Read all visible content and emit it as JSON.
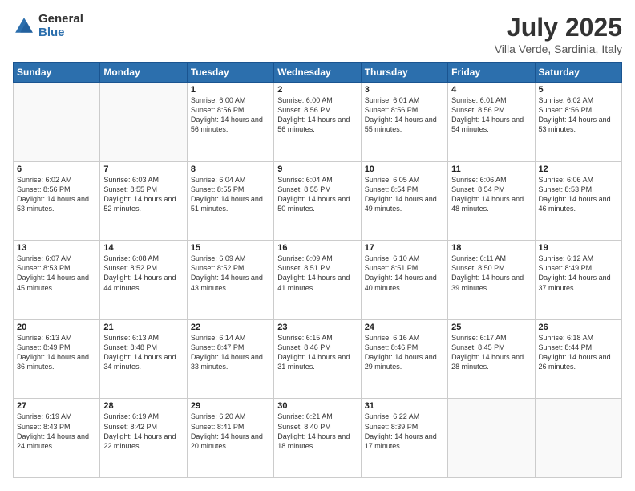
{
  "header": {
    "logo_general": "General",
    "logo_blue": "Blue",
    "title": "July 2025",
    "subtitle": "Villa Verde, Sardinia, Italy"
  },
  "calendar": {
    "days_of_week": [
      "Sunday",
      "Monday",
      "Tuesday",
      "Wednesday",
      "Thursday",
      "Friday",
      "Saturday"
    ],
    "weeks": [
      [
        {
          "day": "",
          "sunrise": "",
          "sunset": "",
          "daylight": "",
          "empty": true
        },
        {
          "day": "",
          "sunrise": "",
          "sunset": "",
          "daylight": "",
          "empty": true
        },
        {
          "day": "1",
          "sunrise": "Sunrise: 6:00 AM",
          "sunset": "Sunset: 8:56 PM",
          "daylight": "Daylight: 14 hours and 56 minutes."
        },
        {
          "day": "2",
          "sunrise": "Sunrise: 6:00 AM",
          "sunset": "Sunset: 8:56 PM",
          "daylight": "Daylight: 14 hours and 56 minutes."
        },
        {
          "day": "3",
          "sunrise": "Sunrise: 6:01 AM",
          "sunset": "Sunset: 8:56 PM",
          "daylight": "Daylight: 14 hours and 55 minutes."
        },
        {
          "day": "4",
          "sunrise": "Sunrise: 6:01 AM",
          "sunset": "Sunset: 8:56 PM",
          "daylight": "Daylight: 14 hours and 54 minutes."
        },
        {
          "day": "5",
          "sunrise": "Sunrise: 6:02 AM",
          "sunset": "Sunset: 8:56 PM",
          "daylight": "Daylight: 14 hours and 53 minutes."
        }
      ],
      [
        {
          "day": "6",
          "sunrise": "Sunrise: 6:02 AM",
          "sunset": "Sunset: 8:56 PM",
          "daylight": "Daylight: 14 hours and 53 minutes."
        },
        {
          "day": "7",
          "sunrise": "Sunrise: 6:03 AM",
          "sunset": "Sunset: 8:55 PM",
          "daylight": "Daylight: 14 hours and 52 minutes."
        },
        {
          "day": "8",
          "sunrise": "Sunrise: 6:04 AM",
          "sunset": "Sunset: 8:55 PM",
          "daylight": "Daylight: 14 hours and 51 minutes."
        },
        {
          "day": "9",
          "sunrise": "Sunrise: 6:04 AM",
          "sunset": "Sunset: 8:55 PM",
          "daylight": "Daylight: 14 hours and 50 minutes."
        },
        {
          "day": "10",
          "sunrise": "Sunrise: 6:05 AM",
          "sunset": "Sunset: 8:54 PM",
          "daylight": "Daylight: 14 hours and 49 minutes."
        },
        {
          "day": "11",
          "sunrise": "Sunrise: 6:06 AM",
          "sunset": "Sunset: 8:54 PM",
          "daylight": "Daylight: 14 hours and 48 minutes."
        },
        {
          "day": "12",
          "sunrise": "Sunrise: 6:06 AM",
          "sunset": "Sunset: 8:53 PM",
          "daylight": "Daylight: 14 hours and 46 minutes."
        }
      ],
      [
        {
          "day": "13",
          "sunrise": "Sunrise: 6:07 AM",
          "sunset": "Sunset: 8:53 PM",
          "daylight": "Daylight: 14 hours and 45 minutes."
        },
        {
          "day": "14",
          "sunrise": "Sunrise: 6:08 AM",
          "sunset": "Sunset: 8:52 PM",
          "daylight": "Daylight: 14 hours and 44 minutes."
        },
        {
          "day": "15",
          "sunrise": "Sunrise: 6:09 AM",
          "sunset": "Sunset: 8:52 PM",
          "daylight": "Daylight: 14 hours and 43 minutes."
        },
        {
          "day": "16",
          "sunrise": "Sunrise: 6:09 AM",
          "sunset": "Sunset: 8:51 PM",
          "daylight": "Daylight: 14 hours and 41 minutes."
        },
        {
          "day": "17",
          "sunrise": "Sunrise: 6:10 AM",
          "sunset": "Sunset: 8:51 PM",
          "daylight": "Daylight: 14 hours and 40 minutes."
        },
        {
          "day": "18",
          "sunrise": "Sunrise: 6:11 AM",
          "sunset": "Sunset: 8:50 PM",
          "daylight": "Daylight: 14 hours and 39 minutes."
        },
        {
          "day": "19",
          "sunrise": "Sunrise: 6:12 AM",
          "sunset": "Sunset: 8:49 PM",
          "daylight": "Daylight: 14 hours and 37 minutes."
        }
      ],
      [
        {
          "day": "20",
          "sunrise": "Sunrise: 6:13 AM",
          "sunset": "Sunset: 8:49 PM",
          "daylight": "Daylight: 14 hours and 36 minutes."
        },
        {
          "day": "21",
          "sunrise": "Sunrise: 6:13 AM",
          "sunset": "Sunset: 8:48 PM",
          "daylight": "Daylight: 14 hours and 34 minutes."
        },
        {
          "day": "22",
          "sunrise": "Sunrise: 6:14 AM",
          "sunset": "Sunset: 8:47 PM",
          "daylight": "Daylight: 14 hours and 33 minutes."
        },
        {
          "day": "23",
          "sunrise": "Sunrise: 6:15 AM",
          "sunset": "Sunset: 8:46 PM",
          "daylight": "Daylight: 14 hours and 31 minutes."
        },
        {
          "day": "24",
          "sunrise": "Sunrise: 6:16 AM",
          "sunset": "Sunset: 8:46 PM",
          "daylight": "Daylight: 14 hours and 29 minutes."
        },
        {
          "day": "25",
          "sunrise": "Sunrise: 6:17 AM",
          "sunset": "Sunset: 8:45 PM",
          "daylight": "Daylight: 14 hours and 28 minutes."
        },
        {
          "day": "26",
          "sunrise": "Sunrise: 6:18 AM",
          "sunset": "Sunset: 8:44 PM",
          "daylight": "Daylight: 14 hours and 26 minutes."
        }
      ],
      [
        {
          "day": "27",
          "sunrise": "Sunrise: 6:19 AM",
          "sunset": "Sunset: 8:43 PM",
          "daylight": "Daylight: 14 hours and 24 minutes."
        },
        {
          "day": "28",
          "sunrise": "Sunrise: 6:19 AM",
          "sunset": "Sunset: 8:42 PM",
          "daylight": "Daylight: 14 hours and 22 minutes."
        },
        {
          "day": "29",
          "sunrise": "Sunrise: 6:20 AM",
          "sunset": "Sunset: 8:41 PM",
          "daylight": "Daylight: 14 hours and 20 minutes."
        },
        {
          "day": "30",
          "sunrise": "Sunrise: 6:21 AM",
          "sunset": "Sunset: 8:40 PM",
          "daylight": "Daylight: 14 hours and 18 minutes."
        },
        {
          "day": "31",
          "sunrise": "Sunrise: 6:22 AM",
          "sunset": "Sunset: 8:39 PM",
          "daylight": "Daylight: 14 hours and 17 minutes."
        },
        {
          "day": "",
          "sunrise": "",
          "sunset": "",
          "daylight": "",
          "empty": true
        },
        {
          "day": "",
          "sunrise": "",
          "sunset": "",
          "daylight": "",
          "empty": true
        }
      ]
    ]
  }
}
